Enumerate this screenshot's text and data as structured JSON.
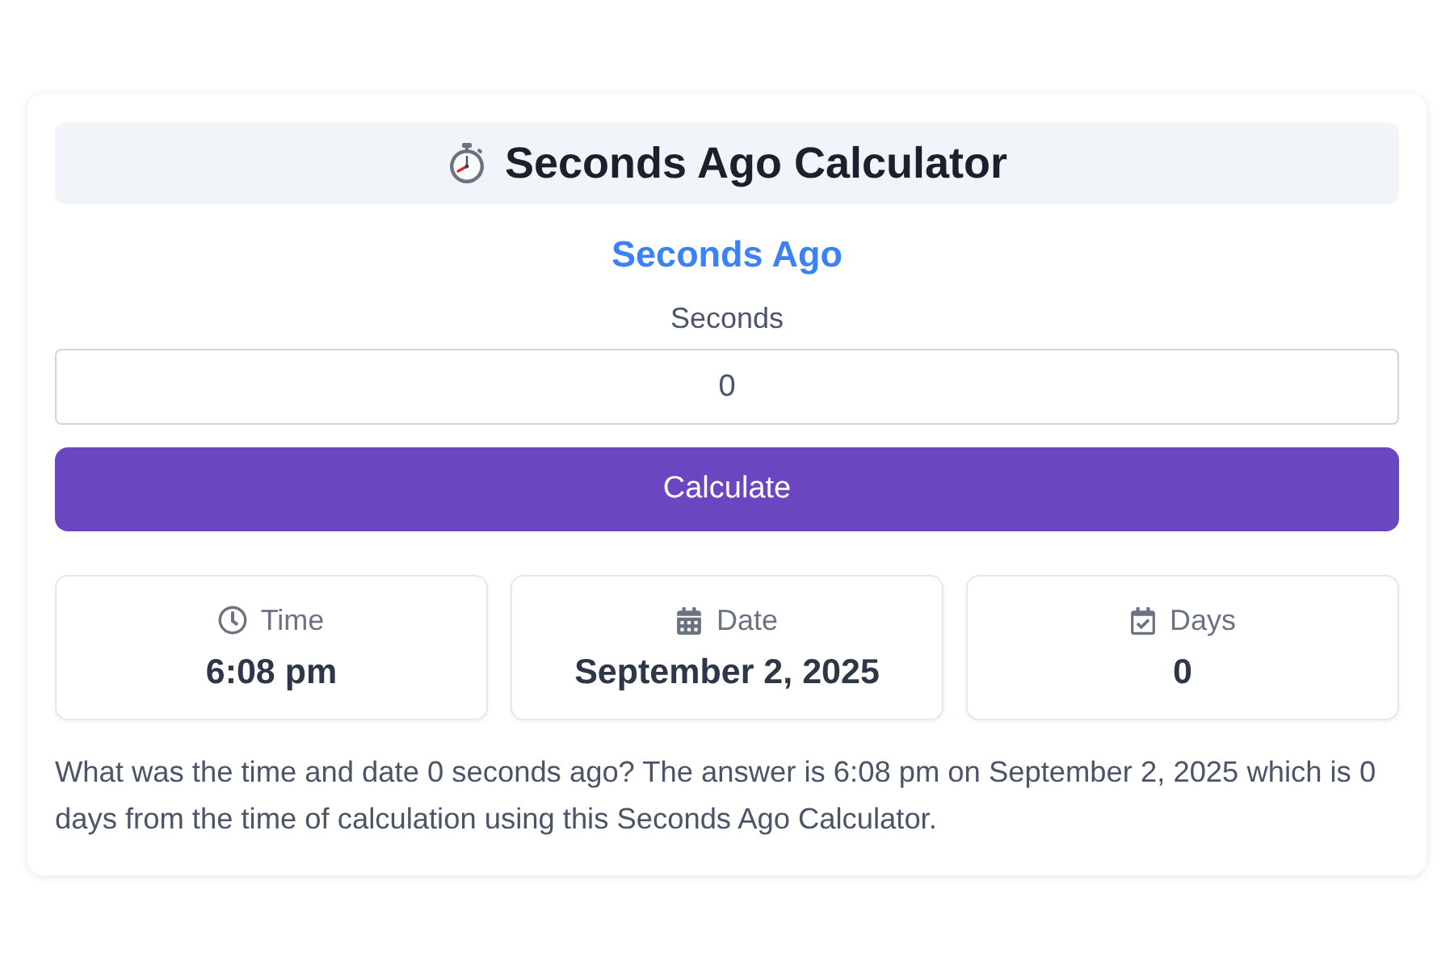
{
  "header": {
    "title": "Seconds Ago Calculator"
  },
  "subtitle": "Seconds Ago",
  "field": {
    "label": "Seconds",
    "value": "0"
  },
  "button": {
    "label": "Calculate"
  },
  "results": [
    {
      "kind": "time",
      "label": "Time",
      "value": "6:08 pm"
    },
    {
      "kind": "date",
      "label": "Date",
      "value": "September 2, 2025"
    },
    {
      "kind": "days",
      "label": "Days",
      "value": "0"
    }
  ],
  "summary": "What was the time and date 0 seconds ago? The answer is 6:08 pm on September 2, 2025 which is 0 days from the time of calculation using this Seconds Ago Calculator."
}
